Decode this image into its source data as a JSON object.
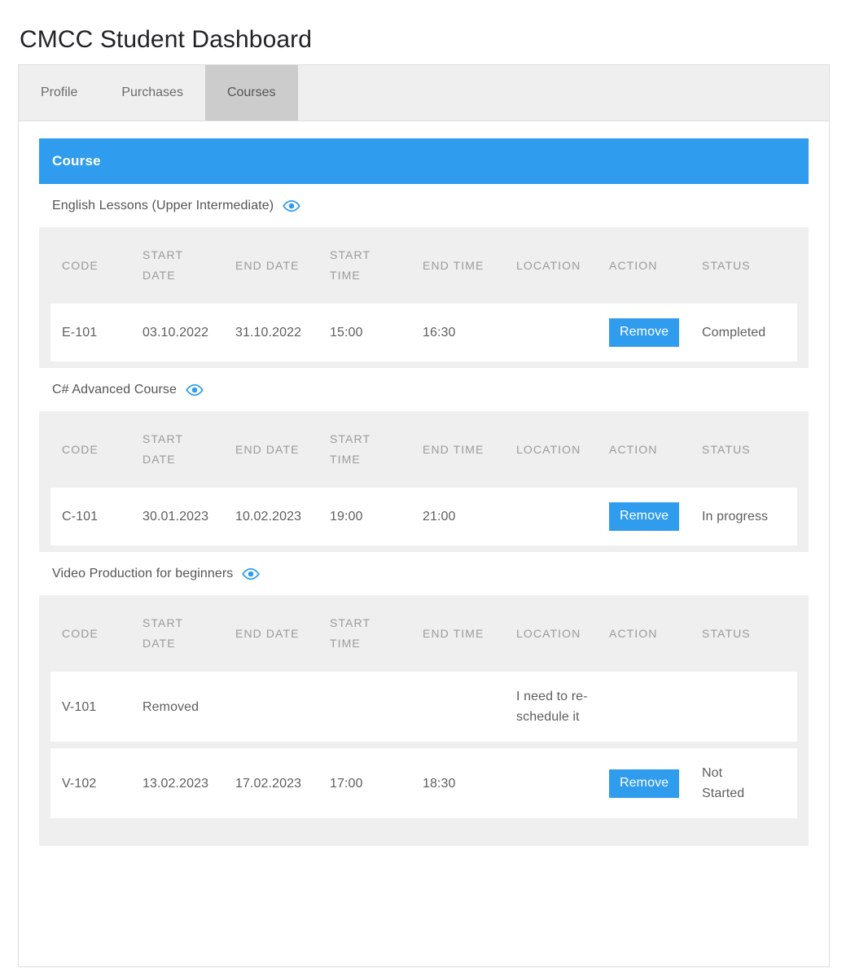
{
  "page": {
    "title": "CMCC Student Dashboard"
  },
  "tabs": [
    {
      "label": "Profile",
      "active": false
    },
    {
      "label": "Purchases",
      "active": false
    },
    {
      "label": "Courses",
      "active": true
    }
  ],
  "course_panel": {
    "header_label": "Course",
    "header_color": "#2f9ced",
    "columns": [
      "CODE",
      "START DATE",
      "END DATE",
      "START TIME",
      "END TIME",
      "LOCATION",
      "ACTION",
      "STATUS"
    ],
    "remove_button_label": "Remove",
    "eye_icon_name": "eye-icon",
    "eye_icon_color": "#2f9ced",
    "removed_text_color": "#fb0707",
    "courses": [
      {
        "name": "English Lessons (Upper Intermediate)",
        "rows": [
          {
            "code": "E-101",
            "start_date": "03.10.2022",
            "end_date": "31.10.2022",
            "start_time": "15:00",
            "end_time": "16:30",
            "location": "",
            "has_remove": true,
            "status": "Completed",
            "removed": false
          }
        ]
      },
      {
        "name": "C# Advanced Course",
        "rows": [
          {
            "code": "C-101",
            "start_date": "30.01.2023",
            "end_date": "10.02.2023",
            "start_time": "19:00",
            "end_time": "21:00",
            "location": "",
            "has_remove": true,
            "status": "In progress",
            "removed": false
          }
        ]
      },
      {
        "name": "Video Production for beginners",
        "rows": [
          {
            "code": "V-101",
            "start_date": "Removed",
            "end_date": "",
            "start_time": "",
            "end_time": "",
            "location": "I need to re-schedule it",
            "has_remove": false,
            "status": "",
            "removed": true
          },
          {
            "code": "V-102",
            "start_date": "13.02.2023",
            "end_date": "17.02.2023",
            "start_time": "17:00",
            "end_time": "18:30",
            "location": "",
            "has_remove": true,
            "status": "Not Started",
            "removed": false
          }
        ]
      }
    ]
  }
}
